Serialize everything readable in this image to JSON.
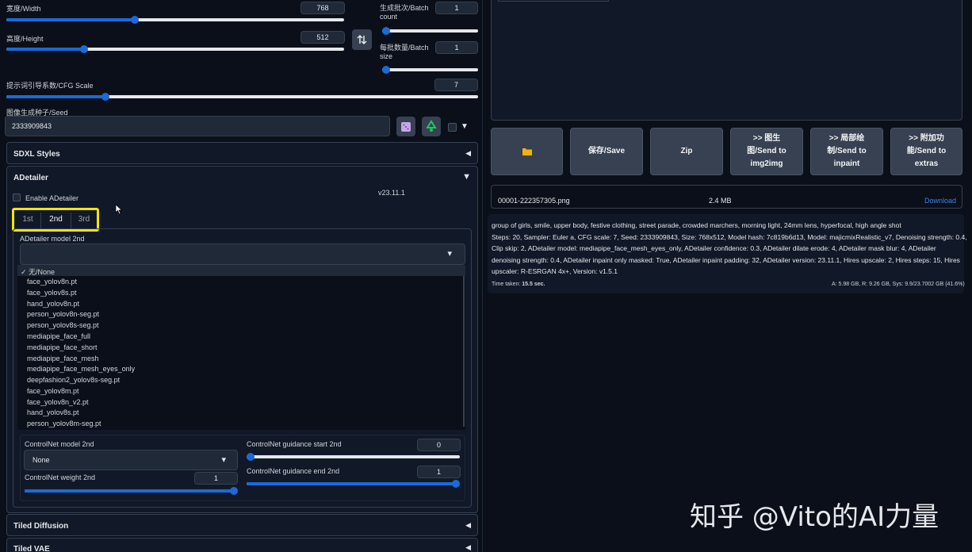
{
  "width": {
    "label": "宽度/Width",
    "value": "768",
    "fraction": 0.38
  },
  "height": {
    "label": "高度/Height",
    "value": "512",
    "fraction": 0.23
  },
  "swap_icon": "swap-arrows-icon",
  "batch_count": {
    "label_line1": "生成批次/Batch",
    "label_line2": "count",
    "value": "1",
    "fraction": 0.0
  },
  "batch_size": {
    "label_line1": "每批数量/Batch",
    "label_line2": "size",
    "value": "1",
    "fraction": 0.0
  },
  "cfg": {
    "label": "提示词引导系数/CFG Scale",
    "value": "7",
    "fraction": 0.21
  },
  "seed": {
    "label": "图像生成种子/Seed",
    "value": "2333909843",
    "dice_icon": "dice-icon",
    "recycle_icon": "recycle-icon"
  },
  "sdxl_styles": {
    "title": "SDXL Styles",
    "arrow": "◀"
  },
  "adetailer": {
    "title": "ADetailer",
    "arrow": "▼",
    "enable_label": "Enable ADetailer",
    "version": "v23.11.1",
    "tabs": [
      "1st",
      "2nd",
      "3rd"
    ],
    "model_label": "ADetailer model 2nd",
    "dropdown_arrow": "▾",
    "options": [
      "✓ 无/None",
      "face_yolov8n.pt",
      "face_yolov8s.pt",
      "hand_yolov8n.pt",
      "person_yolov8n-seg.pt",
      "person_yolov8s-seg.pt",
      "mediapipe_face_full",
      "mediapipe_face_short",
      "mediapipe_face_mesh",
      "mediapipe_face_mesh_eyes_only",
      "deepfashion2_yolov8s-seg.pt",
      "face_yolov8m.pt",
      "face_yolov8n_v2.pt",
      "hand_yolov8s.pt",
      "person_yolov8m-seg.pt"
    ],
    "controlnet_model_label": "ControlNet model 2nd",
    "controlnet_model_value": "None",
    "controlnet_weight_label": "ControlNet weight 2nd",
    "controlnet_weight_value": "1",
    "controlnet_weight_fraction": 1.0,
    "guidance_start_label": "ControlNet guidance start 2nd",
    "guidance_start_value": "0",
    "guidance_start_fraction": 0.0,
    "guidance_end_label": "ControlNet guidance end 2nd",
    "guidance_end_value": "1",
    "guidance_end_fraction": 1.0
  },
  "tiled_diffusion": {
    "title": "Tiled Diffusion",
    "arrow": "◀"
  },
  "tiled_vae": {
    "title": "Tiled VAE",
    "arrow": "◀"
  },
  "output_buttons": {
    "folder_icon": "folder-icon",
    "save": "保存/Save",
    "zip": "Zip",
    "img2img_l1": ">> 图生",
    "img2img_l2": "图/Send to",
    "img2img_l3": "img2img",
    "inpaint_l1": ">> 局部绘",
    "inpaint_l2": "制/Send to",
    "inpaint_l3": "inpaint",
    "extras_l1": ">> 附加功",
    "extras_l2": "能/Send to",
    "extras_l3": "extras"
  },
  "file": {
    "name": "00001-222357305.png",
    "size": "2.4 MB",
    "download": "Download"
  },
  "info": {
    "prompt": "group of girls, smile, upper body, festive clothing, street parade, crowded marchers, morning light, 24mm lens, hyperfocal, high angle shot",
    "line1": "Steps: 20, Sampler: Euler a, CFG scale: 7, Seed: 2333909843, Size: 768x512, Model hash: 7c819b6d13, Model: majicmixRealistic_v7, Denoising strength: 0.4,",
    "line2": "Clip skip: 2, ADetailer model: mediapipe_face_mesh_eyes_only, ADetailer confidence: 0.3, ADetailer dilate erode: 4, ADetailer mask blur: 4, ADetailer",
    "line3": "denoising strength: 0.4, ADetailer inpaint only masked: True, ADetailer inpaint padding: 32, ADetailer version: 23.11.1, Hires upscale: 2, Hires steps: 15, Hires",
    "line4": "upscaler: R-ESRGAN 4x+, Version: v1.5.1"
  },
  "time_taken_label": "Time taken:",
  "time_taken_value": "15.5 sec.",
  "memory": "A: 5.98 GB, R: 9.26 GB, Sys: 9.9/23.7002 GB (41.6%)",
  "watermark": "知乎 @Vito的AI力量",
  "colors": {
    "accent": "#1b6ad8",
    "highlight": "#f5e400",
    "background": "#0b0f19",
    "panel": "#111827"
  }
}
